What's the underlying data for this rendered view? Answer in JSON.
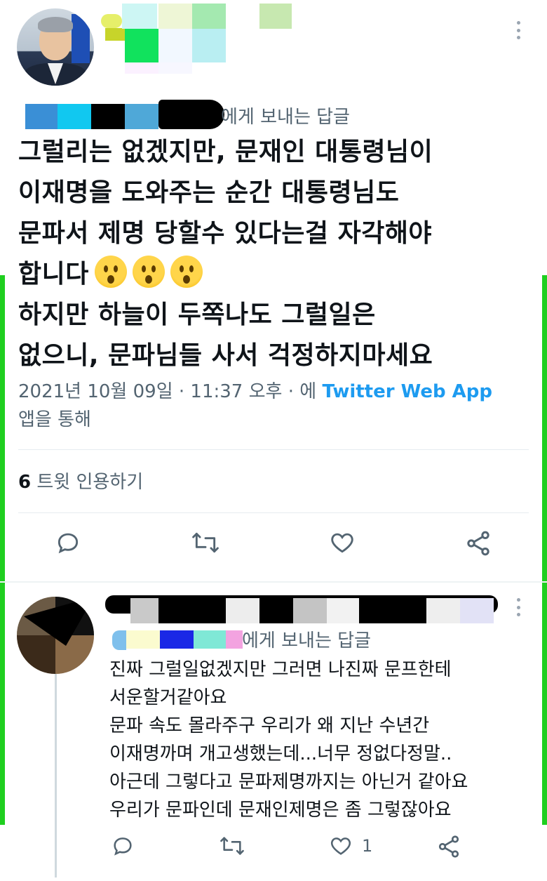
{
  "main_tweet": {
    "reply_to_suffix": "에게 보내는 답글",
    "text_lines": [
      "그럴리는 없겠지만, 문재인 대통령님이",
      "이재명을 도와주는 순간 대통령님도",
      "문파서 제명 당할수 있다는걸 자각해야",
      "합니다",
      "하지만 하늘이 두쪽나도 그럴일은",
      "없으니, 문파님들 사서 걱정하지마세요"
    ],
    "timestamp": "2021년 10월 09일 · 11:37 오후 · 에",
    "source_app": "Twitter Web App",
    "source_suffix": "앱을 통해",
    "quote_count": "6",
    "quote_label": "트윗 인용하기",
    "icons": [
      "reply-icon",
      "retweet-icon",
      "like-icon",
      "share-icon",
      "more-icon"
    ],
    "accent_color": "#1d9bf0"
  },
  "reply_tweet": {
    "reply_to_suffix": "에게 보내는 답글",
    "text_lines": [
      "진짜 그럴일없겠지만 그러면 나진짜 문프한테",
      "서운할거같아요",
      "문파 속도 몰라주구 우리가 왜 지난 수년간",
      "이재명까며 개고생했는데...너무 정없다정말..",
      "아근데 그렇다고 문파제명까지는 아닌거 같아요",
      "우리가 문파인데 문재인제명은 좀 그렇잖아요"
    ],
    "like_count": "1"
  },
  "highlight_color": "#1fcf1f"
}
